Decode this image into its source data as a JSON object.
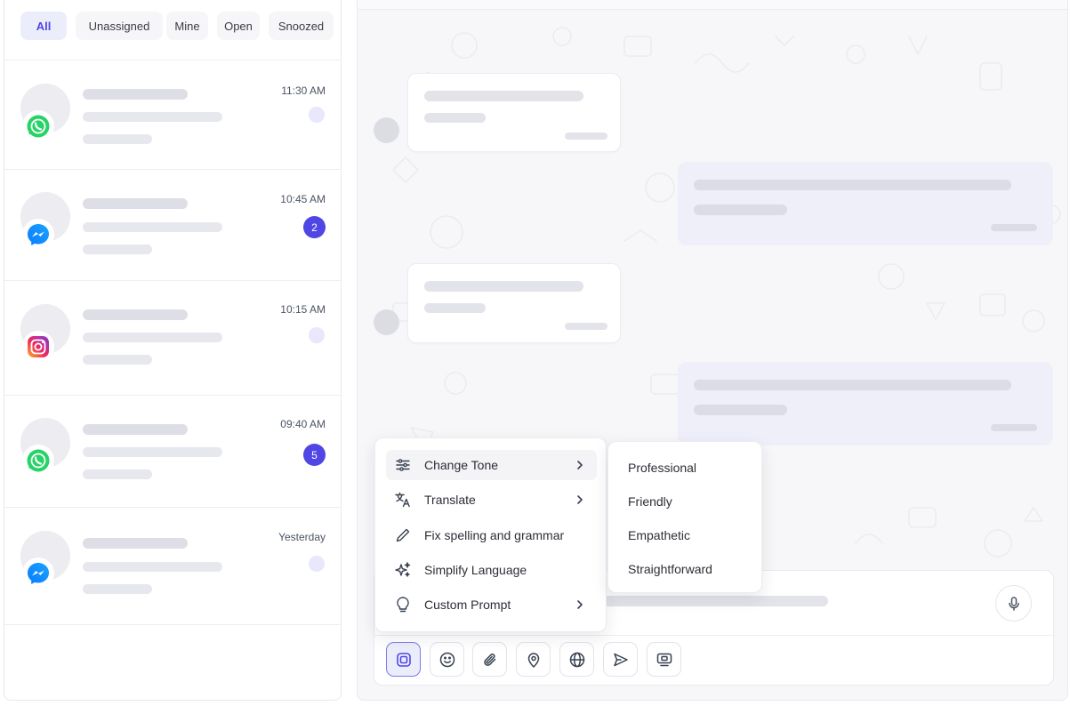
{
  "filters": {
    "tabs": [
      {
        "label": "All",
        "active": true
      },
      {
        "label": "Unassigned",
        "active": false
      },
      {
        "label": "Mine",
        "active": false
      },
      {
        "label": "Open",
        "active": false
      },
      {
        "label": "Snoozed",
        "active": false
      }
    ]
  },
  "conversations": [
    {
      "channel": "whatsapp-icon",
      "time": "11:30 AM",
      "unread": ""
    },
    {
      "channel": "messenger-icon",
      "time": "10:45 AM",
      "unread": "2"
    },
    {
      "channel": "instagram-icon",
      "time": "10:15 AM",
      "unread": ""
    },
    {
      "channel": "whatsapp-icon",
      "time": "09:40 AM",
      "unread": "5"
    },
    {
      "channel": "messenger-icon",
      "time": "Yesterday",
      "unread": ""
    }
  ],
  "ai_menu": {
    "items": [
      {
        "label": "Change Tone",
        "icon": "sliders-icon",
        "has_submenu": true
      },
      {
        "label": "Translate",
        "icon": "translate-icon",
        "has_submenu": true
      },
      {
        "label": "Fix spelling and grammar",
        "icon": "pencil-icon",
        "has_submenu": false
      },
      {
        "label": "Simplify Language",
        "icon": "sparkles-icon",
        "has_submenu": false
      },
      {
        "label": "Custom Prompt",
        "icon": "lightbulb-icon",
        "has_submenu": true
      }
    ]
  },
  "tone_submenu": {
    "items": [
      "Professional",
      "Friendly",
      "Empathetic",
      "Straightforward"
    ]
  },
  "toolbar": {
    "tools": [
      "ai-assist-icon",
      "emoji-icon",
      "attachment-icon",
      "location-icon",
      "globe-icon",
      "send-icon",
      "screen-icon"
    ]
  },
  "colors": {
    "accent": "#4f46e5",
    "whatsapp": "#25d366",
    "messenger": "#1877f2"
  }
}
